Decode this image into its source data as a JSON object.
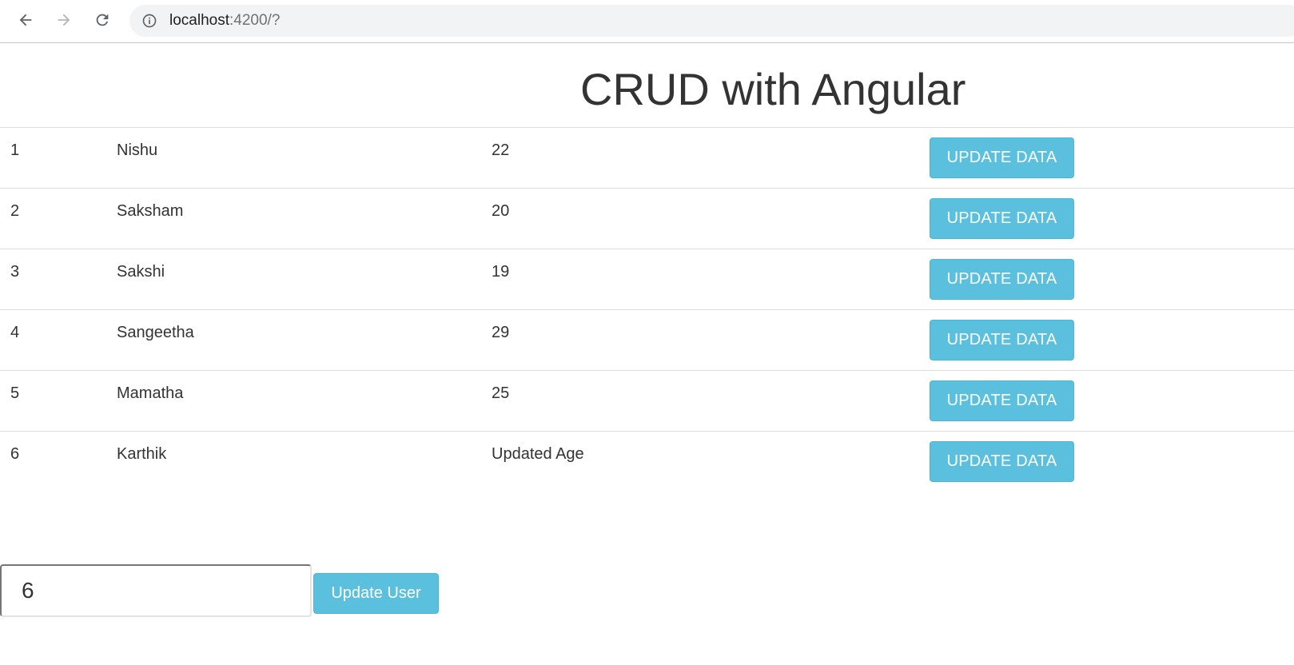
{
  "browser": {
    "url_host": "localhost",
    "url_rest": ":4200/?",
    "icons": {
      "back": "arrow-left-icon",
      "forward": "arrow-right-icon",
      "reload": "reload-icon",
      "site_info": "info-icon"
    }
  },
  "page": {
    "title": "CRUD with Angular"
  },
  "table": {
    "rows": [
      {
        "id": "1",
        "name": "Nishu",
        "age": "22",
        "button_label": "UPDATE DATA"
      },
      {
        "id": "2",
        "name": "Saksham",
        "age": "20",
        "button_label": "UPDATE DATA"
      },
      {
        "id": "3",
        "name": "Sakshi",
        "age": "19",
        "button_label": "UPDATE DATA"
      },
      {
        "id": "4",
        "name": "Sangeetha",
        "age": "29",
        "button_label": "UPDATE DATA"
      },
      {
        "id": "5",
        "name": "Mamatha",
        "age": "25",
        "button_label": "UPDATE DATA"
      },
      {
        "id": "6",
        "name": "Karthik",
        "age": "Updated Age",
        "button_label": "UPDATE DATA"
      }
    ]
  },
  "form": {
    "id_value": "6",
    "submit_label": "Update User"
  },
  "colors": {
    "button_info": "#5bc0de",
    "button_info_border": "#46b8da",
    "text": "#333333"
  }
}
